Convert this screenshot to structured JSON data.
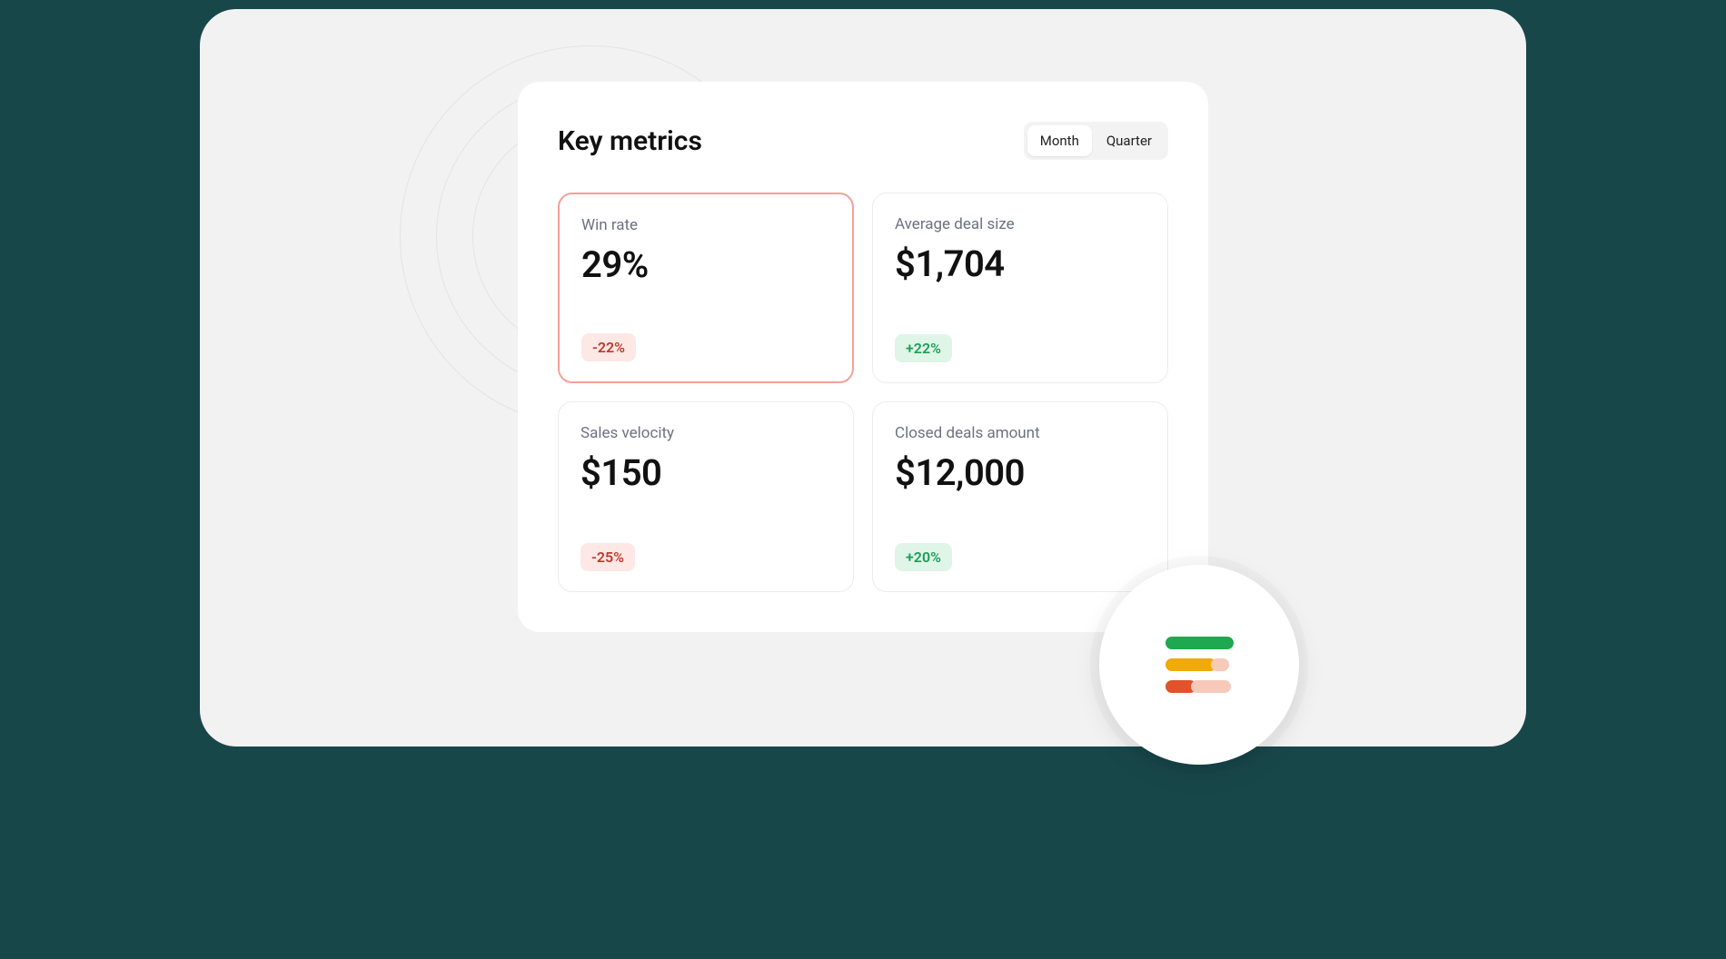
{
  "panel": {
    "title": "Key metrics",
    "timeframe": {
      "options": [
        "Month",
        "Quarter"
      ],
      "selected": "Month"
    }
  },
  "metrics": [
    {
      "label": "Win rate",
      "value": "29%",
      "delta": "-22%",
      "direction": "neg",
      "highlight": true
    },
    {
      "label": "Average deal size",
      "value": "$1,704",
      "delta": "+22%",
      "direction": "pos",
      "highlight": false
    },
    {
      "label": "Sales velocity",
      "value": "$150",
      "delta": "-25%",
      "direction": "neg",
      "highlight": false
    },
    {
      "label": "Closed deals amount",
      "value": "$12,000",
      "delta": "+20%",
      "direction": "pos",
      "highlight": false
    }
  ],
  "float_icon": {
    "name": "bar-list-icon",
    "colors": {
      "green": "#1ea84f",
      "gold": "#f1a90b",
      "red": "#e0532b",
      "tail": "#f6c9b9"
    }
  }
}
